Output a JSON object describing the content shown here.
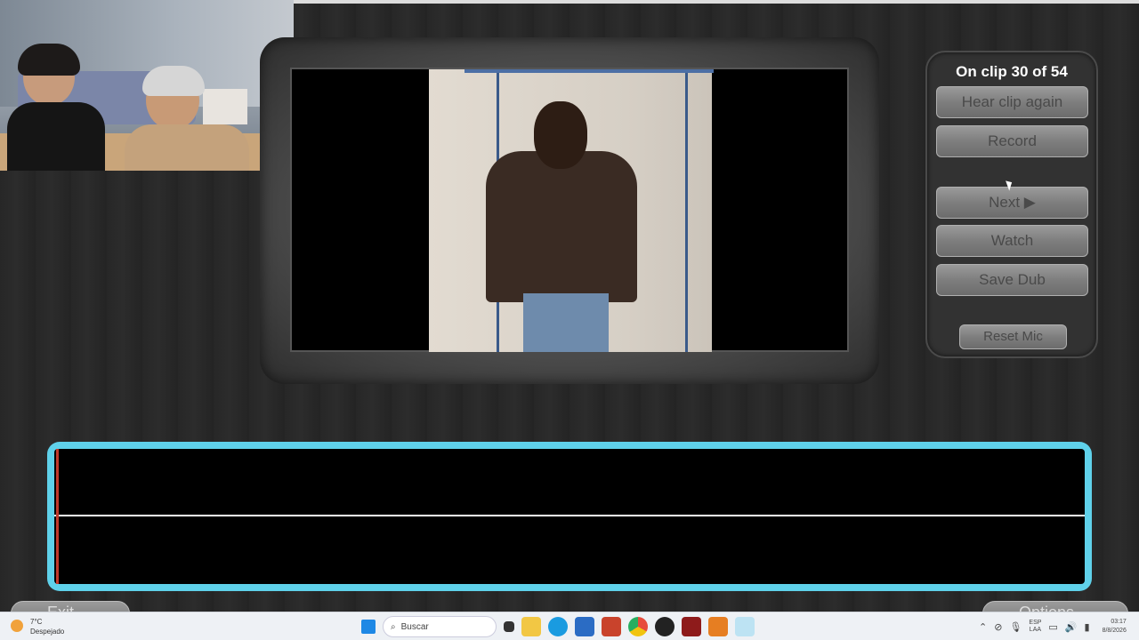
{
  "panel": {
    "clip_status": "On clip 30 of 54",
    "buttons": {
      "hear_again": "Hear clip again",
      "record": "Record",
      "next": "Next ▶",
      "watch": "Watch",
      "save_dub": "Save Dub",
      "reset_mic": "Reset Mic"
    }
  },
  "bottom": {
    "exit_label": "Exit",
    "options_label": "Options"
  },
  "taskbar": {
    "weather_temp": "7°C",
    "weather_desc": "Despejado",
    "search_placeholder": "Buscar",
    "lang_top": "ESP",
    "lang_bottom": "LAA",
    "time": "03:17",
    "date": "8/8/2026"
  },
  "colors": {
    "waveform_border": "#5fd1ea",
    "button_gray": "#8a8a8a",
    "background": "#2a2a2a"
  }
}
